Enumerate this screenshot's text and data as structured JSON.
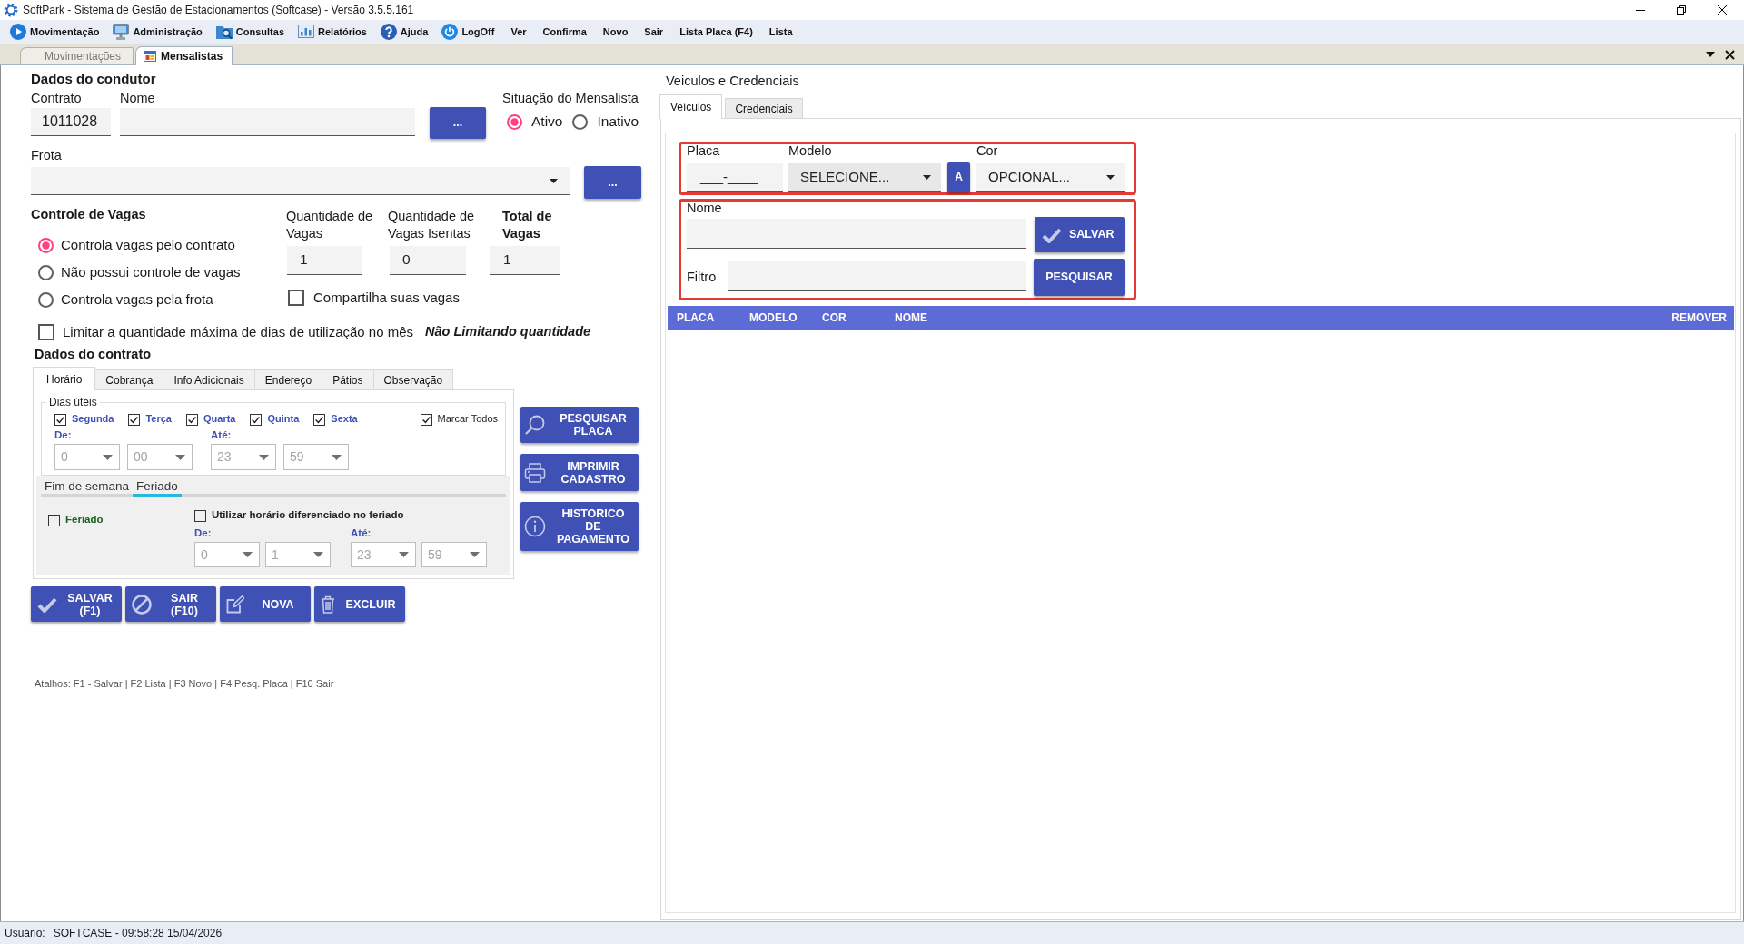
{
  "window": {
    "title": "SoftPark - Sistema de Gestão de Estacionamentos (Softcase) - Versão 3.5.5.161"
  },
  "menu": {
    "main": [
      "Movimentação",
      "Administração",
      "Consultas",
      "Relatórios",
      "Ajuda",
      "LogOff"
    ],
    "commands": [
      "Ver",
      "Confirma",
      "Novo",
      "Sair",
      "Lista Placa (F4)",
      "Lista"
    ]
  },
  "document_tabs": [
    {
      "label": "Movimentações",
      "selected": false
    },
    {
      "label": "Mensalistas",
      "selected": true
    }
  ],
  "driver": {
    "title": "Dados do condutor",
    "contract": {
      "label": "Contrato",
      "value": "1011028"
    },
    "name": {
      "label": "Nome"
    },
    "lookup_button": "...",
    "status": {
      "label": "Situação do Mensalista",
      "options": [
        {
          "label": "Ativo",
          "selected": true
        },
        {
          "label": "Inativo",
          "selected": false
        }
      ]
    }
  },
  "fleet": {
    "label": "Frota",
    "lookup_button": "..."
  },
  "spaces": {
    "title": "Controle de Vagas",
    "options": [
      {
        "label": "Controla vagas pelo contrato",
        "selected": true
      },
      {
        "label": "Não possui controle de vagas",
        "selected": false
      },
      {
        "label": "Controla vagas pela frota",
        "selected": false
      }
    ],
    "counts": [
      {
        "kind": "count",
        "label": "Quantidade de Vagas",
        "value": "1"
      },
      {
        "kind": "count",
        "label": "Quantidade de Vagas Isentas",
        "value": "0"
      },
      {
        "kind": "total",
        "label": "Total de Vagas",
        "value": "1"
      }
    ],
    "share": {
      "label": "Compartilha suas vagas",
      "checked": false
    }
  },
  "limit": {
    "label": "Limitar a quantidade máxima de dias de utilização no mês",
    "checked": false,
    "note": "Não Limitando quantidade"
  },
  "contract": {
    "title": "Dados do contrato",
    "tabs": [
      {
        "label": "Horário",
        "selected": true
      },
      {
        "label": "Cobrança",
        "selected": false
      },
      {
        "label": "Info Adicionais",
        "selected": false
      },
      {
        "label": "Endereço",
        "selected": false
      },
      {
        "label": "Pátios",
        "selected": false
      },
      {
        "label": "Observação",
        "selected": false
      }
    ],
    "weekdays": {
      "legend": "Dias úteis",
      "days": [
        {
          "label": "Segunda",
          "checked": true
        },
        {
          "label": "Terça",
          "checked": true
        },
        {
          "label": "Quarta",
          "checked": true
        },
        {
          "label": "Quinta",
          "checked": true
        },
        {
          "label": "Sexta",
          "checked": true
        }
      ],
      "select_all": {
        "label": "Marcar Todos",
        "checked": true
      },
      "from_label": "De:",
      "to_label": "Até:",
      "disabled": true,
      "times": [
        "0",
        "00",
        "23",
        "59"
      ]
    },
    "day_types": [
      {
        "label": "Fim de semana",
        "selected": false
      },
      {
        "label": "Feriado",
        "selected": true
      }
    ],
    "holiday": {
      "label": "Feriado",
      "checked": false
    },
    "holiday_schedule": {
      "label": "Utilizar horário diferenciado no feriado",
      "checked": false,
      "from_label": "De:",
      "to_label": "Até:",
      "disabled": true,
      "times": [
        "0",
        "1",
        "23",
        "59"
      ]
    }
  },
  "side_buttons": [
    "PESQUISAR PLACA",
    "IMPRIMIR CADASTRO",
    "HISTORICO DE PAGAMENTO"
  ],
  "actions": [
    "SALVAR (F1)",
    "SAIR (F10)",
    "NOVA",
    "EXCLUIR"
  ],
  "shortcuts": "Atalhos: F1 - Salvar | F2 Lista | F3 Novo | F4 Pesq. Placa | F10 Sair",
  "vehicles": {
    "title": "Veiculos e Credenciais",
    "tabs": [
      {
        "label": "Veículos",
        "selected": true
      },
      {
        "label": "Credenciais",
        "selected": false
      }
    ],
    "plate": {
      "label": "Placa",
      "value": "___-____"
    },
    "model": {
      "label": "Modelo",
      "value": "SELECIONE..."
    },
    "model_button": "A",
    "color": {
      "label": "Cor",
      "value": "OPCIONAL..."
    },
    "name": {
      "label": "Nome"
    },
    "save_button": "SALVAR",
    "filter": {
      "label": "Filtro"
    },
    "search_button": "PESQUISAR",
    "table": {
      "columns": [
        "PLACA",
        "MODELO",
        "COR",
        "NOME",
        "REMOVER"
      ]
    }
  },
  "status_bar": {
    "label": "Usuário:",
    "value": "SOFTCASE - 09:58:28 15/04/2026"
  }
}
